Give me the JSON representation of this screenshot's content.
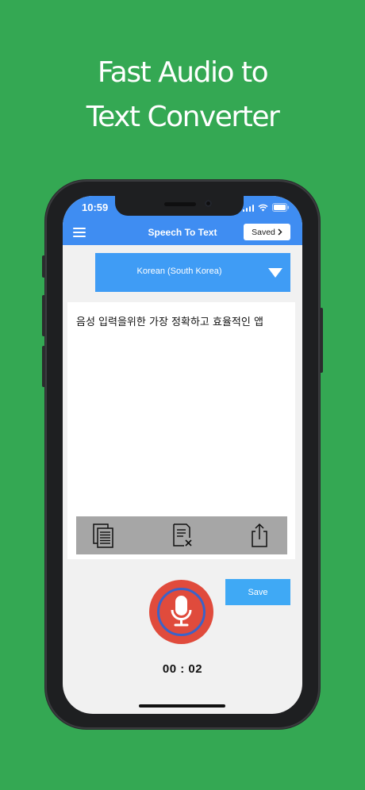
{
  "headline": {
    "line1": "Fast Audio to",
    "line2": "Text Converter"
  },
  "status_bar": {
    "time": "10:59"
  },
  "app_bar": {
    "title": "Speech To Text",
    "saved_label": "Saved"
  },
  "language_selector": {
    "selected": "Korean (South Korea)"
  },
  "transcript": {
    "text": "음성 입력을위한 가장 정확하고 효율적인 앱"
  },
  "toolbar": {
    "tools": [
      "copy-icon",
      "clear-text-icon",
      "share-icon"
    ]
  },
  "actions": {
    "save_label": "Save"
  },
  "recording": {
    "elapsed": "00 : 02"
  },
  "colors": {
    "background": "#34a853",
    "app_bar": "#3f8df2",
    "selector": "#3f9cf5",
    "mic": "#e04b3c",
    "save": "#3fa9f5"
  }
}
